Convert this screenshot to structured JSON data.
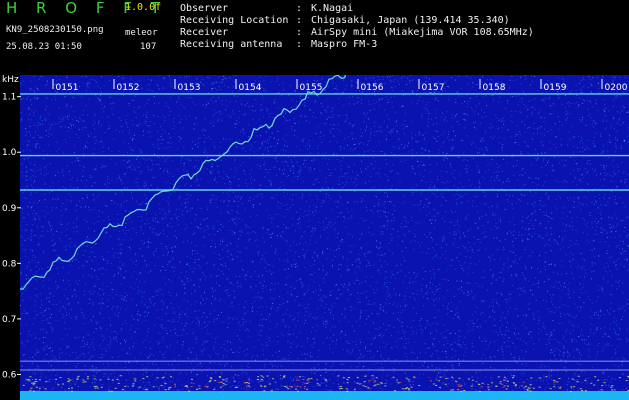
{
  "app": {
    "title": "H R O F F T",
    "version": "1.0.0f",
    "filename": "KN9_2508230150.png",
    "mode": "meleor",
    "timestamp": "25.08.23 01:50",
    "count": "107"
  },
  "info": [
    {
      "label": "Observer",
      "value": "K.Nagai"
    },
    {
      "label": "Receiving Location",
      "value": "Chigasaki, Japan (139.414 35.340)"
    },
    {
      "label": "Receiver",
      "value": "AirSpy mini (Miakejima VOR 108.65MHz)"
    },
    {
      "label": "Receiving antenna",
      "value": "Maspro FM-3"
    }
  ],
  "spectrogram": {
    "y_unit": "kHz",
    "y_ticks": [
      "1.1",
      "1.0",
      "0.9",
      "0.8",
      "0.7",
      "0.6"
    ],
    "y_range": [
      0.58,
      1.18
    ],
    "time_ticks": [
      "0151",
      "0152",
      "0153",
      "0154",
      "0155",
      "0156",
      "0157",
      "0158",
      "0159",
      "0200"
    ],
    "horizontal_lines_khz": [
      1.105,
      0.994,
      0.932,
      0.624,
      0.608
    ],
    "colors": {
      "background": "#0a12b0",
      "noise": "#2f7cff",
      "line": "#6ee6e6",
      "trace": "#7df0d8",
      "grid": "#cfd8ff"
    }
  }
}
